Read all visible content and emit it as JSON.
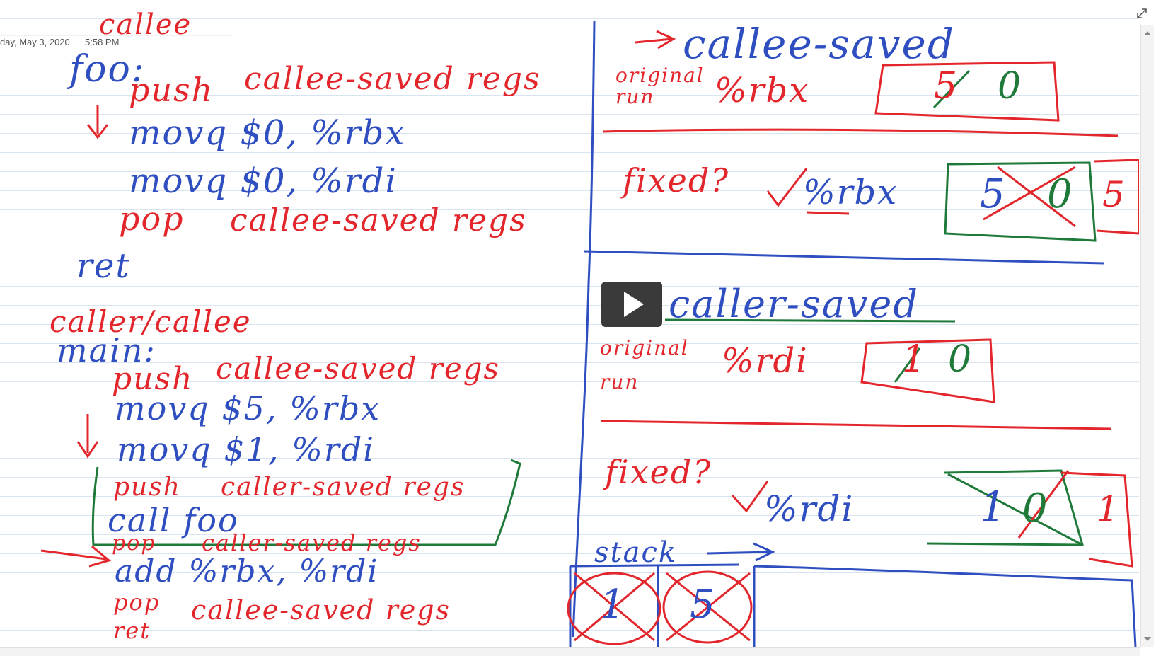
{
  "page": {
    "date": "day, May 3, 2020",
    "time": "5:58 PM"
  },
  "left": {
    "callee_title": "callee",
    "foo_label": "foo:",
    "foo_push": "push",
    "foo_push_desc": "callee-saved regs",
    "foo_movq1": "movq $0, %rbx",
    "foo_movq2": "movq $0, %rdi",
    "foo_pop": "pop",
    "foo_pop_desc": "callee-saved regs",
    "foo_ret": "ret",
    "caller_callee_title": "caller/callee",
    "main_label": "main:",
    "main_push": "push",
    "main_push_desc": "callee-saved regs",
    "main_movq1": "movq $5, %rbx",
    "main_movq2": "movq $1, %rdi",
    "main_push2": "push",
    "main_push2_desc": "caller-saved regs",
    "main_call": "call foo",
    "main_pop2": "pop",
    "main_pop2_desc": "caller-saved regs",
    "main_add": "add %rbx, %rdi",
    "main_pop": "pop",
    "main_pop_desc": "callee-saved regs",
    "main_ret": "ret"
  },
  "right": {
    "callee_saved_title": "callee-saved",
    "orig_run_label": "original run",
    "rbx_label": "%rbx",
    "rbx_box_old": "5",
    "rbx_box_new": "0",
    "fixed_label": "fixed?",
    "fixed_rbx_label": "%rbx",
    "fixed_rbx_old": "5",
    "fixed_rbx_new": "0",
    "fixed_rbx_restored": "5",
    "caller_saved_title": "caller-saved",
    "orig_run_label2": "original run",
    "rdi_label": "%rdi",
    "rdi_box_old": "1",
    "rdi_box_new": "0",
    "fixed_label2": "fixed?",
    "fixed_rdi_label": "%rdi",
    "fixed_rdi_old": "1",
    "fixed_rdi_new": "0",
    "fixed_rdi_restored": "1",
    "stack_label": "stack",
    "stack_cell1": "1",
    "stack_cell2": "5"
  },
  "colors": {
    "red": "#e3262b",
    "blue": "#2f4fc1",
    "green": "#1f7a3a"
  },
  "controls": {
    "play_icon": "play-icon",
    "expand_icon": "expand-icon"
  }
}
